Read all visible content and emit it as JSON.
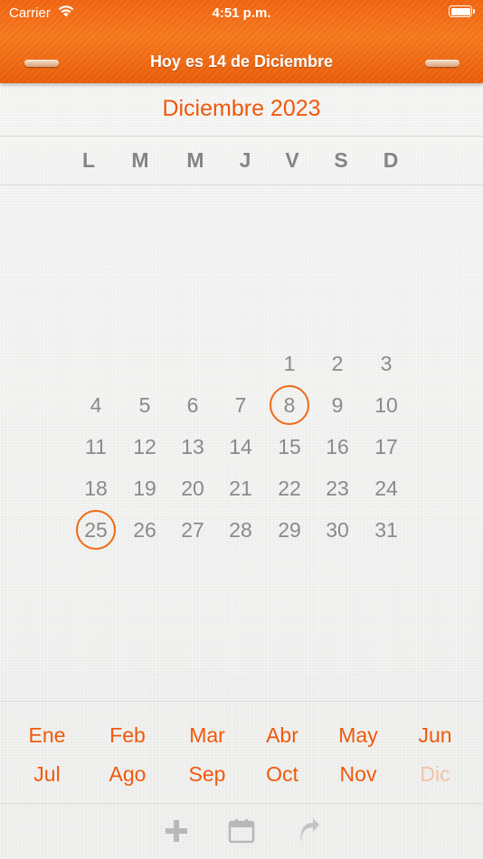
{
  "status_bar": {
    "carrier": "Carrier",
    "time": "4:51 p.m.",
    "wifi_icon": "wifi-icon",
    "battery_icon": "battery-icon"
  },
  "header": {
    "title": "Hoy es 14 de Diciembre",
    "accent_color": "#f0620f"
  },
  "calendar": {
    "month_title": "Diciembre 2023",
    "weekdays": [
      "L",
      "M",
      "M",
      "J",
      "V",
      "S",
      "D"
    ],
    "days": [
      "1",
      "2",
      "3",
      "4",
      "5",
      "6",
      "7",
      "8",
      "9",
      "10",
      "11",
      "12",
      "13",
      "14",
      "15",
      "16",
      "17",
      "18",
      "19",
      "20",
      "21",
      "22",
      "23",
      "24",
      "25",
      "26",
      "27",
      "28",
      "29",
      "30",
      "31"
    ],
    "ringed_days": [
      "8",
      "25"
    ],
    "ring_color": "#ef6a14"
  },
  "month_picker": {
    "months": [
      "Ene",
      "Feb",
      "Mar",
      "Abr",
      "May",
      "Jun",
      "Jul",
      "Ago",
      "Sep",
      "Oct",
      "Nov",
      "Dic"
    ],
    "current": "Dic"
  },
  "toolbar": {
    "items": [
      "add-icon",
      "calendar-icon",
      "share-arrow-icon"
    ]
  }
}
